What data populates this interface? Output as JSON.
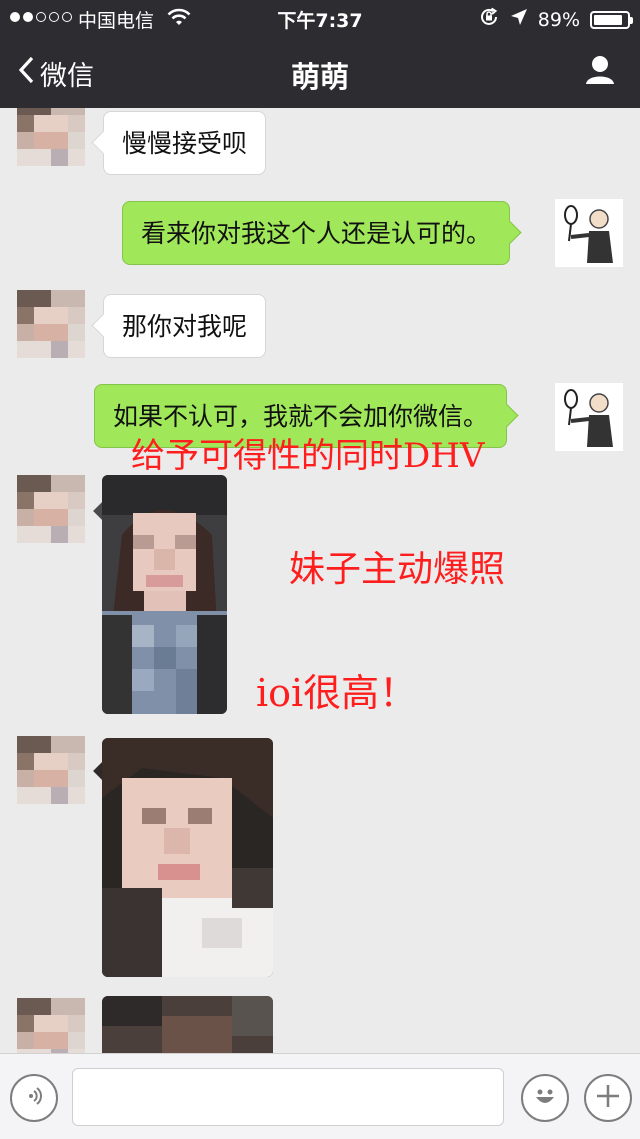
{
  "status_bar": {
    "carrier": "中国电信",
    "time": "下午7:37",
    "battery": "89%",
    "battery_level": 0.89,
    "signal_bars_filled": 2,
    "signal_bars_total": 5,
    "icons": [
      "wifi-icon",
      "orientation-lock-icon",
      "location-arrow-icon",
      "battery-icon"
    ]
  },
  "nav": {
    "back_label": "微信",
    "title": "萌萌",
    "profile_icon": "person-icon"
  },
  "messages": [
    {
      "from": "contact",
      "type": "text",
      "text": "慢慢接受呗"
    },
    {
      "from": "me",
      "type": "text",
      "text": "看来你对我这个人还是认可的。"
    },
    {
      "from": "contact",
      "type": "text",
      "text": "那你对我呢"
    },
    {
      "from": "me",
      "type": "text",
      "text": "如果不认可，我就不会加你微信。"
    },
    {
      "from": "contact",
      "type": "image"
    },
    {
      "from": "contact",
      "type": "image"
    },
    {
      "from": "contact",
      "type": "image"
    }
  ],
  "annotations": {
    "dhv": "给予可得性的同时DHV",
    "photo": "妹子主动爆照",
    "ioi": "ioi很高！"
  },
  "colors": {
    "nav_bg": "#2c2c31",
    "chat_bg": "#ebebeb",
    "outgoing_bubble": "#a0e75a",
    "incoming_bubble": "#ffffff",
    "annotation": "#ff1e1e"
  },
  "input_bar": {
    "voice_icon": "voice-icon",
    "emoji_icon": "emoji-icon",
    "plus_icon": "plus-icon"
  }
}
